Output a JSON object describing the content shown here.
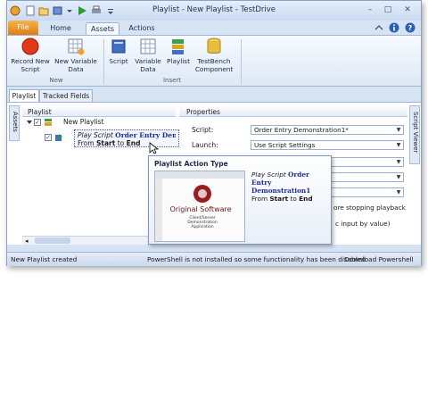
{
  "window": {
    "title": "Playlist - New Playlist - TestDrive"
  },
  "quick_access": [
    "app-orb-icon",
    "new-icon",
    "open-icon",
    "script-icon",
    "run-icon",
    "print-icon",
    "customize-icon"
  ],
  "window_controls": {
    "minimize": "–",
    "restore": "□",
    "close": "✕"
  },
  "ribbon_tabs": {
    "file": "File",
    "home": "Home",
    "assets": "Assets",
    "actions": "Actions"
  },
  "ribbon_right_icons": [
    "collapse-ribbon-icon",
    "info-icon",
    "help-icon"
  ],
  "ribbon": {
    "group_new": {
      "label": "New",
      "record_label_1": "Record New",
      "record_label_2": "Script",
      "variable_label_1": "New Variable",
      "variable_label_2": "Data"
    },
    "group_insert": {
      "label": "Insert",
      "script_label": "Script",
      "variable_label_1": "Variable",
      "variable_label_2": "Data",
      "playlist_label": "Playlist",
      "component_label_1": "TestBench",
      "component_label_2": "Component"
    }
  },
  "panel_tabs": {
    "playlist": "Playlist",
    "tracked": "Tracked Fields"
  },
  "side_tabs": {
    "assets": "Assets",
    "script_viewer": "Script Viewer"
  },
  "tree": {
    "header": "Playlist",
    "root_label": "New Playlist",
    "item": {
      "prefix": "Play Script",
      "name": "Order Entry Demonstration1",
      "from": "From",
      "start": "Start",
      "to": "to",
      "end": "End"
    }
  },
  "properties": {
    "header": "Properties",
    "script_label": "Script:",
    "script_value": "Order Entry Demonstration1*",
    "launch_label": "Launch:",
    "launch_value": "Use Script Settings",
    "checkbox_fragment": "ore stopping playback",
    "input_fragment": "c input by value)"
  },
  "tooltip": {
    "title": "Playlist Action Type",
    "prefix": "Play Script",
    "name": "Order Entry Demonstration1",
    "from": "From",
    "start": "Start",
    "to": "to",
    "end": "End",
    "thumb_brand": "Original Software",
    "thumb_caption": "Client/Server Demonstration Application"
  },
  "statusbar": {
    "left": "New Playlist created",
    "middle": "PowerShell is not installed so some functionality has been disabled",
    "link": "Download Powershell"
  },
  "colors": {
    "file_tab": "#e98a1c",
    "accent": "#1e2c9a",
    "frame": "#d6e3f3"
  }
}
